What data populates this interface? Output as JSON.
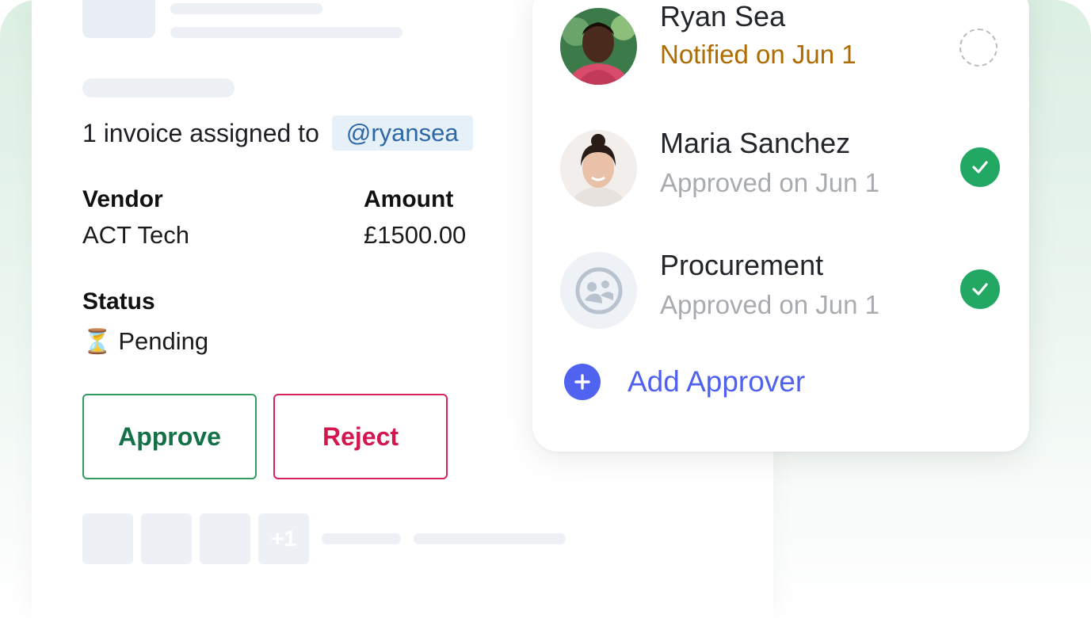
{
  "invoice": {
    "assigned_text": "1 invoice assigned to",
    "assignee": "@ryansea",
    "vendor_label": "Vendor",
    "vendor_value": "ACT Tech",
    "amount_label": "Amount",
    "amount_value": "£1500.00",
    "status_label": "Status",
    "status_icon": "hourglass-icon",
    "status_glyph": "⏳",
    "status_value": "Pending",
    "approve_label": "Approve",
    "reject_label": "Reject",
    "extra_attachments": "+1"
  },
  "approvers": [
    {
      "name": "Ryan Sea",
      "status": "Notified on Jun 1",
      "state": "pending"
    },
    {
      "name": "Maria Sanchez",
      "status": "Approved on Jun 1",
      "state": "approved"
    },
    {
      "name": "Procurement",
      "status": "Approved on Jun 1",
      "state": "approved"
    }
  ],
  "add_approver_label": "Add Approver",
  "colors": {
    "approve": "#137146",
    "reject": "#d3174e",
    "notified": "#ad6b00",
    "approved_check": "#22a862",
    "add_accent": "#5060f0",
    "mention_bg": "#e6f0f8",
    "mention_text": "#2d67a6"
  }
}
